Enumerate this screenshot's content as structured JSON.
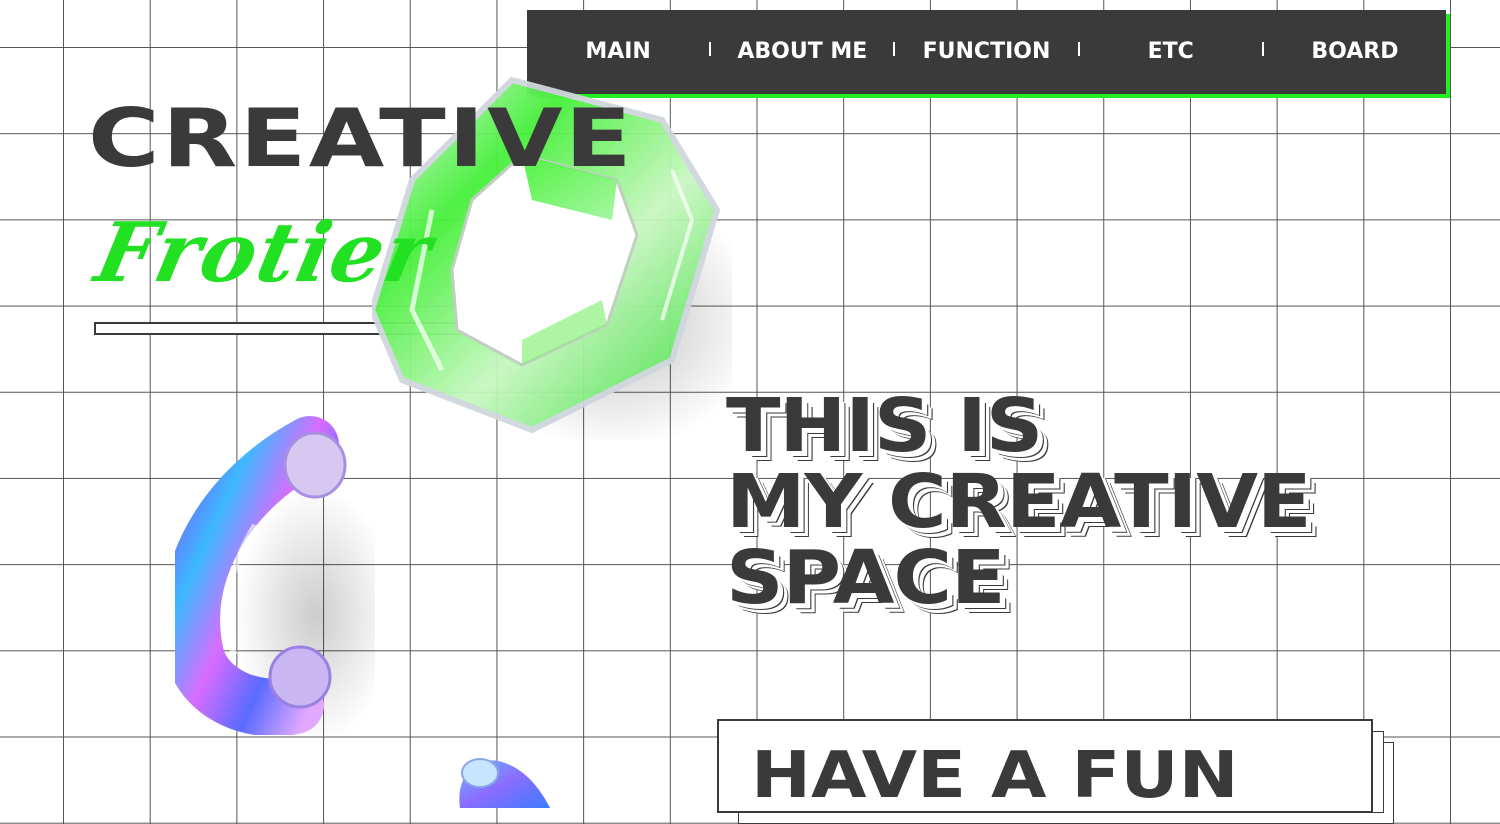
{
  "nav": {
    "items": [
      {
        "label": "MAIN"
      },
      {
        "label": "ABOUT ME"
      },
      {
        "label": "FUNCTION"
      },
      {
        "label": "ETC"
      },
      {
        "label": "BOARD"
      }
    ]
  },
  "hero": {
    "title": "CREATIVE",
    "script": "Frotier"
  },
  "headline": {
    "line1": "THIS IS",
    "line2": "MY CREATIVE",
    "line3": "SPACE"
  },
  "fun": {
    "text": "HAVE A FUN"
  },
  "colors": {
    "accent": "#22e022",
    "dark": "#3a3a3a",
    "grid": "#555555"
  },
  "icons": {
    "hexagon": "glass-hexagon-shape",
    "curve": "holographic-curve-shape",
    "blob": "holographic-blob-shape"
  }
}
